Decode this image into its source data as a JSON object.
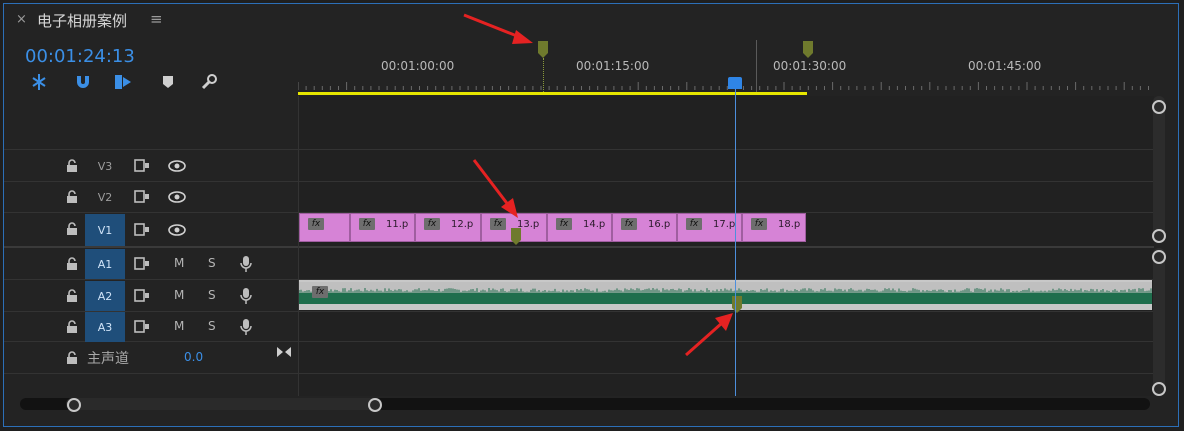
{
  "panel": {
    "close": "×",
    "title": "电子相册案例",
    "menu": "≡"
  },
  "timecode": "00:01:24:13",
  "ruler": {
    "labels": [
      "00:01:00:00",
      "00:01:15:00",
      "00:01:30:00",
      "00:01:45:00"
    ]
  },
  "tracks": {
    "video": [
      {
        "name": "V3",
        "active": false
      },
      {
        "name": "V2",
        "active": false
      },
      {
        "name": "V1",
        "active": true
      }
    ],
    "audio": [
      {
        "name": "A1",
        "m": "M",
        "s": "S"
      },
      {
        "name": "A2",
        "m": "M",
        "s": "S"
      },
      {
        "name": "A3",
        "m": "M",
        "s": "S"
      }
    ],
    "master": {
      "label": "主声道",
      "value": "0.0"
    }
  },
  "clips": [
    {
      "fx": "fx",
      "name": ""
    },
    {
      "fx": "fx",
      "name": "11.p"
    },
    {
      "fx": "fx",
      "name": "12.p"
    },
    {
      "fx": "fx",
      "name": "13.p"
    },
    {
      "fx": "fx",
      "name": "14.p"
    },
    {
      "fx": "fx",
      "name": "16.p"
    },
    {
      "fx": "fx",
      "name": "17.p"
    },
    {
      "fx": "fx",
      "name": "18.p"
    }
  ],
  "audio_clip": {
    "fx": "fx"
  },
  "colors": {
    "accent": "#3b8fe6",
    "video_clip": "#d683d6",
    "in_out_bar": "#e6e600",
    "marker": "#6f7a2d",
    "annotation_arrow": "#e52222"
  }
}
